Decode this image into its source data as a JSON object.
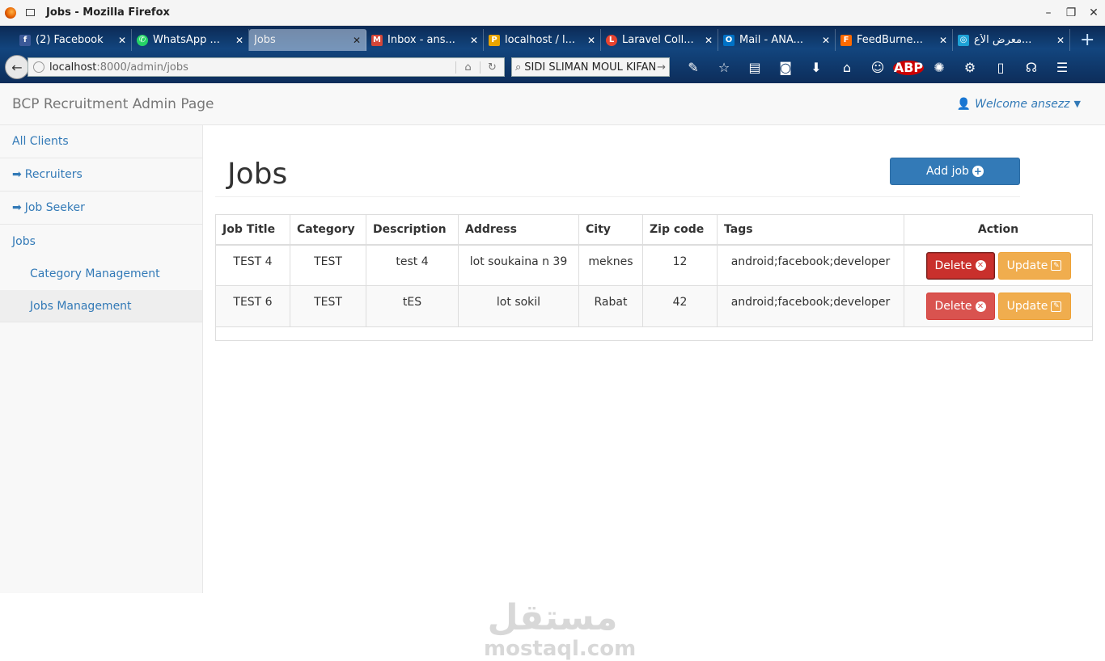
{
  "window": {
    "title": "Jobs - Mozilla Firefox",
    "controls": [
      "–",
      "❐",
      "✕"
    ]
  },
  "tabs": [
    {
      "label": "(2) Facebook",
      "icon": "facebook-icon",
      "color": "#3b5998",
      "glyph": "f"
    },
    {
      "label": "WhatsApp ...",
      "icon": "whatsapp-icon",
      "color": "#25d366",
      "glyph": "✆"
    },
    {
      "label": "Jobs",
      "icon": "",
      "color": "",
      "glyph": "",
      "active": true
    },
    {
      "label": "Inbox - ans...",
      "icon": "gmail-icon",
      "color": "#d44638",
      "glyph": "M"
    },
    {
      "label": "localhost / l...",
      "icon": "phpmyadmin-icon",
      "color": "#e8a400",
      "glyph": "P"
    },
    {
      "label": "Laravel Coll...",
      "icon": "laravel-icon",
      "color": "#e74430",
      "glyph": "L"
    },
    {
      "label": "Mail - ANA...",
      "icon": "outlook-icon",
      "color": "#0072c6",
      "glyph": "O"
    },
    {
      "label": "FeedBurne...",
      "icon": "feedburner-icon",
      "color": "#ff6a00",
      "glyph": "F"
    },
    {
      "label": "معرض الأع...",
      "icon": "site-icon",
      "color": "#1da1d6",
      "glyph": "◎"
    }
  ],
  "nav": {
    "url_host": "localhost",
    "url_path": ":8000/admin/jobs",
    "search_value": "SIDI SLIMAN MOUL KIFAN"
  },
  "header": {
    "brand": "BCP Recruitment Admin Page",
    "welcome": "Welcome ansezz"
  },
  "sidebar": {
    "all_clients": "All Clients",
    "recruiters": "Recruiters",
    "job_seeker": "Job Seeker",
    "jobs": "Jobs",
    "category_management": "Category Management",
    "jobs_management": "Jobs Management"
  },
  "main": {
    "title": "Jobs",
    "add_button": "Add job",
    "columns": [
      "Job Title",
      "Category",
      "Description",
      "Address",
      "City",
      "Zip code",
      "Tags",
      "Action"
    ],
    "rows": [
      {
        "title": "TEST 4",
        "category": "TEST",
        "description": "test 4",
        "address": "lot soukaina n 39",
        "city": "meknes",
        "zip": "12",
        "tags": "android;facebook;developer"
      },
      {
        "title": "TEST 6",
        "category": "TEST",
        "description": "tES",
        "address": "lot sokil",
        "city": "Rabat",
        "zip": "42",
        "tags": "android;facebook;developer"
      }
    ],
    "delete_label": "Delete",
    "update_label": "Update"
  },
  "watermark": {
    "arabic": "مستقل",
    "latin": "mostaql.com"
  }
}
